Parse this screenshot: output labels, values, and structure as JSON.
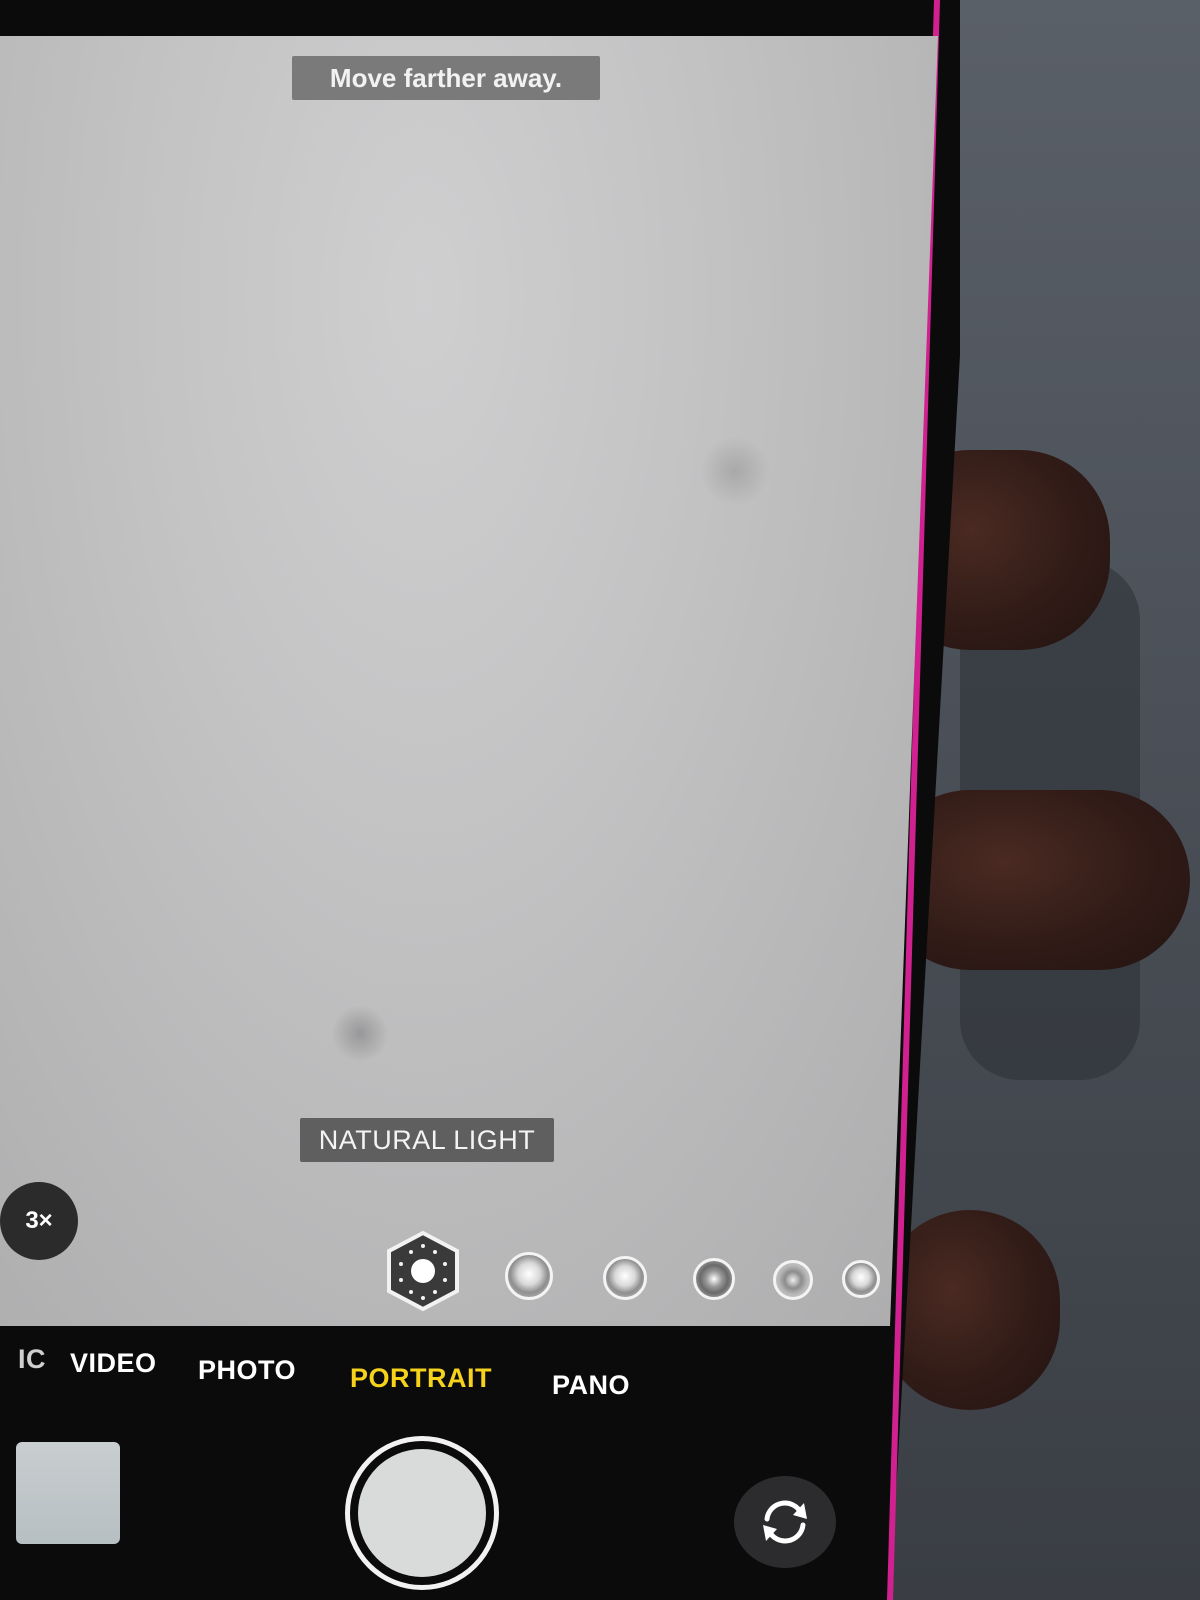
{
  "camera": {
    "hint_text": "Move farther away.",
    "lighting_effect_label": "NATURAL LIGHT",
    "zoom_label": "3×",
    "modes": [
      {
        "label": "IC",
        "selected": false
      },
      {
        "label": "VIDEO",
        "selected": false
      },
      {
        "label": "PHOTO",
        "selected": false
      },
      {
        "label": "PORTRAIT",
        "selected": true
      },
      {
        "label": "PANO",
        "selected": false
      }
    ],
    "lighting_options": [
      {
        "icon": "natural-light-cube-icon",
        "selected": true
      },
      {
        "icon": "studio-light-icon",
        "selected": false
      },
      {
        "icon": "contour-light-icon",
        "selected": false
      },
      {
        "icon": "stage-light-icon",
        "selected": false
      },
      {
        "icon": "stage-light-mono-icon",
        "selected": false
      },
      {
        "icon": "high-key-light-mono-icon",
        "selected": false
      }
    ],
    "colors": {
      "selected_mode": "#f7d21a",
      "edge_accent": "#d1208f"
    }
  }
}
